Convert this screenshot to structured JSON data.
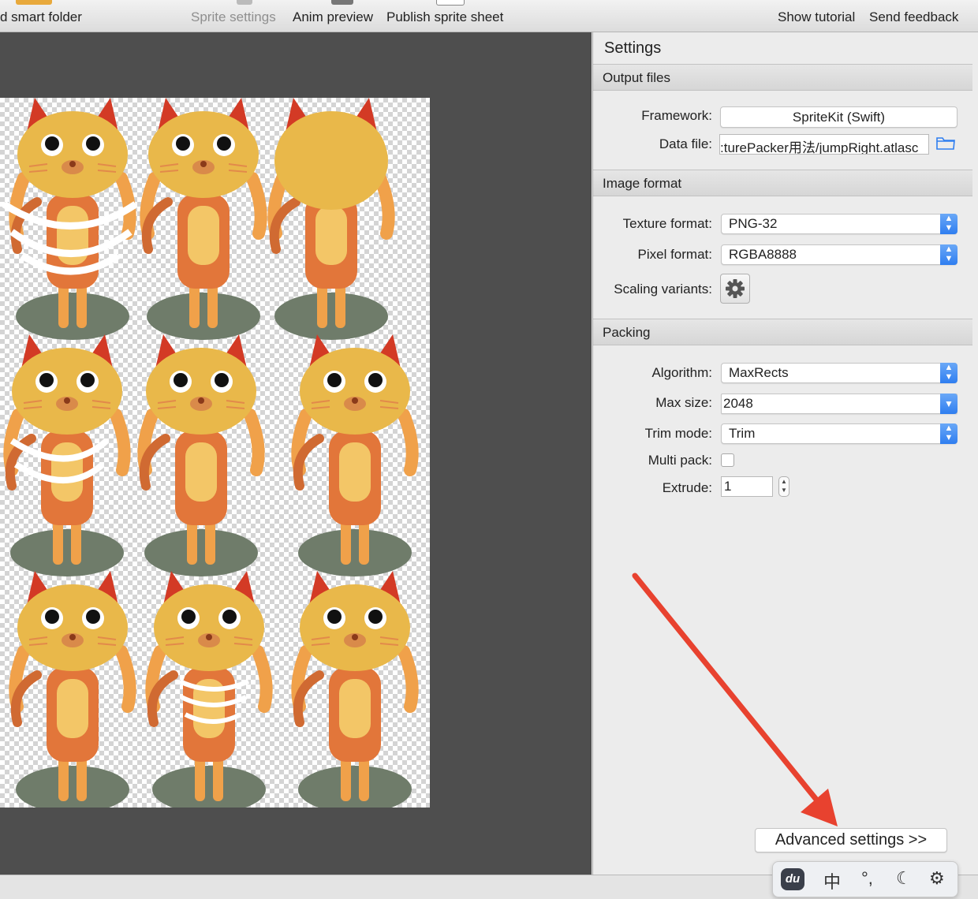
{
  "toolbar": {
    "smart_folder": "d smart folder",
    "sprite_settings": "Sprite settings",
    "anim_preview": "Anim preview",
    "publish": "Publish sprite sheet",
    "show_tutorial": "Show tutorial",
    "send_feedback": "Send feedback"
  },
  "settings": {
    "title": "Settings",
    "output_files": {
      "header": "Output files",
      "framework_label": "Framework:",
      "framework_value": "SpriteKit (Swift)",
      "data_file_label": "Data file:",
      "data_file_value": ":turePacker用法/jumpRight.atlasc",
      "folder_icon": "folder-icon"
    },
    "image_format": {
      "header": "Image format",
      "texture_format_label": "Texture format:",
      "texture_format_value": "PNG-32",
      "pixel_format_label": "Pixel format:",
      "pixel_format_value": "RGBA8888",
      "scaling_variants_label": "Scaling variants:",
      "gear_icon": "gear-icon"
    },
    "packing": {
      "header": "Packing",
      "algorithm_label": "Algorithm:",
      "algorithm_value": "MaxRects",
      "max_size_label": "Max size:",
      "max_size_value": "2048",
      "trim_mode_label": "Trim mode:",
      "trim_mode_value": "Trim",
      "multi_pack_label": "Multi pack:",
      "multi_pack_checked": false,
      "extrude_label": "Extrude:",
      "extrude_value": "1"
    },
    "advanced_button": "Advanced settings >>"
  },
  "ime_toolbar": {
    "logo": "du",
    "chinese": "中",
    "punct": "°,",
    "moon_icon": "moon-icon",
    "gear_icon": "gear-icon"
  },
  "colors": {
    "accent_blue": "#2f7ef0",
    "annotation_arrow": "#e8422f",
    "canvas_bg": "#4e4e4e",
    "cat_body": "#f0a14a",
    "cat_head": "#e9b84a",
    "cat_ear": "#d33a25",
    "shadow": "#6f7c6a"
  },
  "sprites": {
    "count": 9,
    "rows": 3,
    "columns": 3
  }
}
